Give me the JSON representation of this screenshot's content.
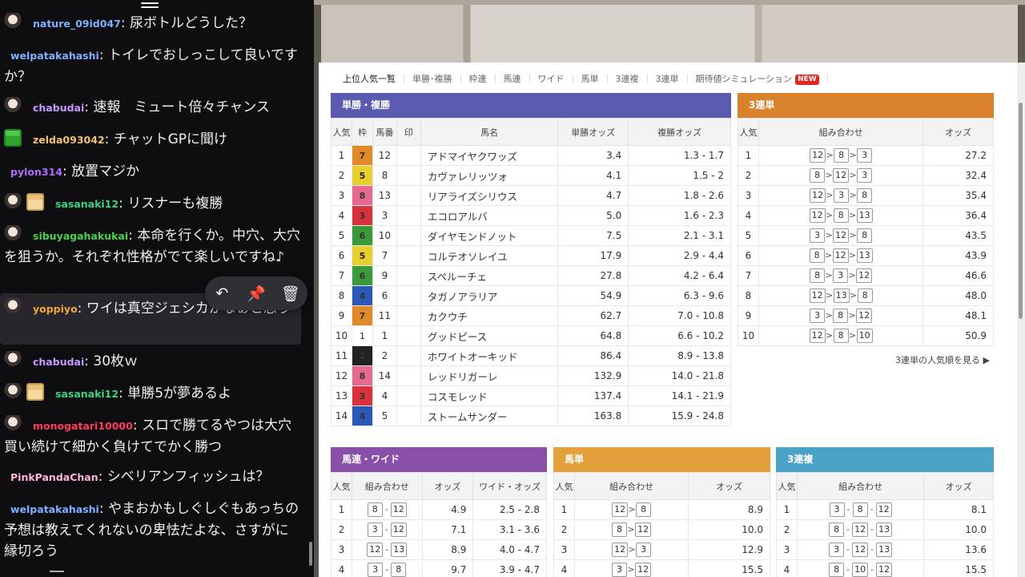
{
  "chat": {
    "messages": [
      {
        "user": "nature_09id047",
        "color": "#7fb0ff",
        "text": "尿ボトルどうした？",
        "badge": "face"
      },
      {
        "user": "welpatakahashi",
        "color": "#7fb0ff",
        "text": "トイレでおしっこして良いですか？",
        "badge": ""
      },
      {
        "user": "chabudai",
        "color": "#c797ff",
        "text": "速報　ミュート倍々チャンス",
        "badge": "face"
      },
      {
        "user": "zelda093042",
        "color": "#f3c26b",
        "text": "チャットGPに聞け",
        "badge": "gift2"
      },
      {
        "user": "pylon314",
        "color": "#b36bff",
        "text": "放置マジか",
        "badge": ""
      },
      {
        "user": "sasanaki12",
        "color": "#3fd17e",
        "text": "リスナーも複勝",
        "badge": "face+gift"
      },
      {
        "user": "sibuyagahakukai",
        "color": "#4ad24a",
        "text": "本命を行くか。中穴、大穴を狙うか。それぞれ性格がでて楽しいですね♪",
        "badge": "face"
      },
      {
        "user": "yoppiyo",
        "color": "#f2a53a",
        "text": "ワイは真空ジェシカかなぁと思う",
        "badge": "face"
      },
      {
        "user": "chabudai",
        "color": "#c797ff",
        "text": "30枚ｗ",
        "badge": "face"
      },
      {
        "user": "sasanaki12",
        "color": "#3fd17e",
        "text": "単勝5が夢あるよ",
        "badge": "face+gift"
      },
      {
        "user": "monogatari10000",
        "color": "#ff3b5c",
        "text": "スロで勝てるやつは大穴買い続けて細かく負けてでかく勝つ",
        "badge": "face"
      },
      {
        "user": "PinkPandaChan",
        "color": "#ffb3d9",
        "text": "シベリアンフィッシュは？",
        "badge": ""
      },
      {
        "user": "welpatakahashi",
        "color": "#7fb0ff",
        "text": "やまおかもしぐしぐもあっちの予想は教えてくれないの卑怯だよな、さすがに縁切ろう",
        "badge": ""
      }
    ],
    "actions": [
      "reply-icon",
      "pin-icon",
      "trash-icon"
    ]
  },
  "tabs": [
    {
      "label": "上位人気一覧",
      "active": true
    },
    {
      "label": "単勝･複勝",
      "active": false
    },
    {
      "label": "枠連",
      "active": false
    },
    {
      "label": "馬連",
      "active": false
    },
    {
      "label": "ワイド",
      "active": false
    },
    {
      "label": "馬単",
      "active": false
    },
    {
      "label": "3連複",
      "active": false
    },
    {
      "label": "3連単",
      "active": false
    },
    {
      "label": "期待値シミュレーション",
      "active": false,
      "badge": "NEW"
    }
  ],
  "win_place": {
    "title": "単勝・複勝",
    "headers": [
      "人気",
      "枠",
      "馬番",
      "印",
      "馬名",
      "単勝オッズ",
      "複勝オッズ"
    ],
    "rows": [
      [
        "1",
        "7",
        "12",
        "アドマイヤクワッズ",
        "3.4",
        "1.3 - 1.7",
        true
      ],
      [
        "2",
        "5",
        "8",
        "カヴァレリッツォ",
        "4.1",
        "1.5 - 2",
        true
      ],
      [
        "3",
        "8",
        "13",
        "リアライズシリウス",
        "4.7",
        "1.8 - 2.6",
        true
      ],
      [
        "4",
        "3",
        "3",
        "エコロアルバ",
        "5.0",
        "1.6 - 2.3",
        true
      ],
      [
        "5",
        "6",
        "10",
        "ダイヤモンドノット",
        "7.5",
        "2.1 - 3.1",
        true
      ],
      [
        "6",
        "5",
        "7",
        "コルテオソレイユ",
        "17.9",
        "2.9 - 4.4",
        false
      ],
      [
        "7",
        "6",
        "9",
        "スペルーチェ",
        "27.8",
        "4.2 - 6.4",
        false
      ],
      [
        "8",
        "4",
        "6",
        "タガノアラリア",
        "54.9",
        "6.3 - 9.6",
        false
      ],
      [
        "9",
        "7",
        "11",
        "カクウチ",
        "62.7",
        "7.0 - 10.8",
        false
      ],
      [
        "10",
        "1",
        "1",
        "グッドピース",
        "64.8",
        "6.6 - 10.2",
        false
      ],
      [
        "11",
        "2",
        "2",
        "ホワイトオーキッド",
        "86.4",
        "8.9 - 13.8",
        false
      ],
      [
        "12",
        "8",
        "14",
        "レッドリガーレ",
        "132.9",
        "14.0 - 21.8",
        false
      ],
      [
        "13",
        "3",
        "4",
        "コスモレッド",
        "137.4",
        "14.1 - 21.9",
        false
      ],
      [
        "14",
        "4",
        "5",
        "ストームサンダー",
        "163.8",
        "15.9 - 24.8",
        false
      ]
    ],
    "waku_colors": {
      "1": "#ffffff",
      "2": "#222222",
      "3": "#d8323c",
      "4": "#2a58b8",
      "5": "#e8cf2e",
      "6": "#3a9a3a",
      "7": "#e08a2a",
      "8": "#e6698f"
    }
  },
  "trifecta": {
    "title": "3連単",
    "headers": [
      "人気",
      "組み合わせ",
      "オッズ"
    ],
    "rows": [
      [
        "1",
        [
          "12",
          "8",
          "3"
        ],
        "27.2"
      ],
      [
        "2",
        [
          "8",
          "12",
          "3"
        ],
        "32.4"
      ],
      [
        "3",
        [
          "12",
          "3",
          "8"
        ],
        "35.4"
      ],
      [
        "4",
        [
          "12",
          "8",
          "13"
        ],
        "36.4"
      ],
      [
        "5",
        [
          "3",
          "12",
          "8"
        ],
        "43.5"
      ],
      [
        "6",
        [
          "8",
          "12",
          "13"
        ],
        "43.9"
      ],
      [
        "7",
        [
          "8",
          "3",
          "12"
        ],
        "46.6"
      ],
      [
        "8",
        [
          "12",
          "13",
          "8"
        ],
        "48.0"
      ],
      [
        "9",
        [
          "3",
          "8",
          "12"
        ],
        "48.1"
      ],
      [
        "10",
        [
          "12",
          "8",
          "10"
        ],
        "50.9"
      ]
    ],
    "more": "3連単の人気順を見る"
  },
  "quinella": {
    "title": "馬連・ワイド",
    "headers": [
      "人気",
      "組み合わせ",
      "オッズ",
      "ワイド・オッズ"
    ],
    "rows": [
      [
        "1",
        [
          "8",
          "12"
        ],
        "4.9",
        "2.5 - 2.8"
      ],
      [
        "2",
        [
          "3",
          "12"
        ],
        "7.1",
        "3.1 - 3.6"
      ],
      [
        "3",
        [
          "12",
          "13"
        ],
        "8.9",
        "4.0 - 4.7"
      ],
      [
        "4",
        [
          "3",
          "8"
        ],
        "9.7",
        "3.9 - 4.7"
      ]
    ]
  },
  "exacta": {
    "title": "馬単",
    "headers": [
      "人気",
      "組み合わせ",
      "オッズ"
    ],
    "rows": [
      [
        "1",
        [
          "12",
          "8"
        ],
        "8.9"
      ],
      [
        "2",
        [
          "8",
          "12"
        ],
        "10.0"
      ],
      [
        "3",
        [
          "12",
          "3"
        ],
        "12.9"
      ],
      [
        "4",
        [
          "3",
          "12"
        ],
        "15.5"
      ]
    ]
  },
  "trio": {
    "title": "3連複",
    "headers": [
      "人気",
      "組み合わせ",
      "オッズ"
    ],
    "rows": [
      [
        "1",
        [
          "3",
          "8",
          "12"
        ],
        "8.1"
      ],
      [
        "2",
        [
          "8",
          "12",
          "13"
        ],
        "10.0"
      ],
      [
        "3",
        [
          "3",
          "12",
          "13"
        ],
        "13.6"
      ],
      [
        "4",
        [
          "8",
          "10",
          "12"
        ],
        "15.5"
      ]
    ]
  },
  "colors": {
    "win_place": "#5a5ab0",
    "trifecta": "#d9822b",
    "quinella": "#8a4fa8",
    "exacta": "#e2a13b",
    "trio": "#4aa3c6"
  }
}
